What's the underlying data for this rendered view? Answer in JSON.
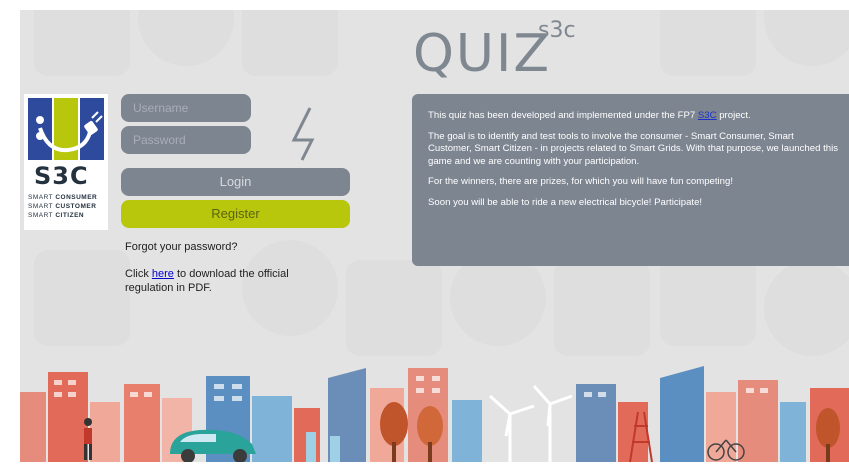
{
  "header": {
    "title": "QUIZ",
    "superscript": "s3c"
  },
  "logo": {
    "name": "S3C",
    "tagline": [
      {
        "prefix": "SMART ",
        "word": "CONSUMER"
      },
      {
        "prefix": "SMART ",
        "word": "CUSTOMER"
      },
      {
        "prefix": "SMART ",
        "word": "CITIZEN"
      }
    ]
  },
  "login_form": {
    "username_placeholder": "Username",
    "password_placeholder": "Password",
    "login_label": "Login",
    "register_label": "Register",
    "forgot_password": "Forgot your password?",
    "regulation_prefix": "Click ",
    "regulation_link": "here",
    "regulation_suffix": " to download the official regulation in PDF."
  },
  "info": {
    "p1_prefix": "This quiz has been developed and implemented under the FP7 ",
    "p1_link": "S3C",
    "p1_suffix": " project.",
    "p2": "The goal is to identify and test tools to involve the consumer - Smart Consumer, Smart Customer, Smart Citizen - in projects related to Smart Grids. With that purpose, we launched this game and we are counting with your participation.",
    "p3": "For the winners, there are prizes, for which you will have fun competing!",
    "p4": "Soon you will be able to ride a new electrical bicycle! Participate!"
  },
  "colors": {
    "panel": "#7d8591",
    "accent": "#b9c70c",
    "background": "#e3e3e3",
    "link": "#1a30c8"
  }
}
